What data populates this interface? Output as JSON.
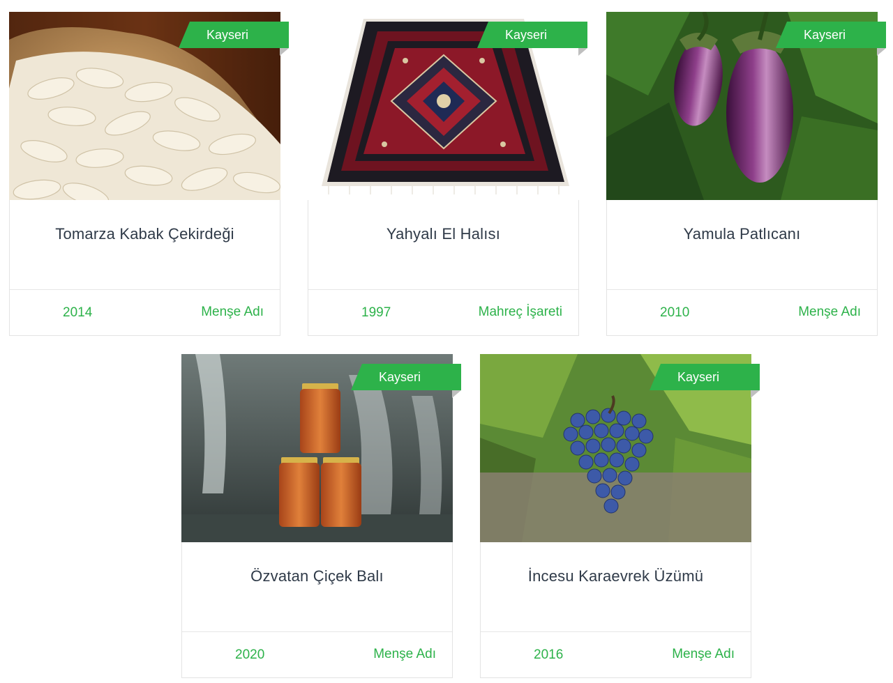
{
  "products": [
    {
      "region": "Kayseri",
      "name": "Tomarza Kabak Çekirdeği",
      "year": "2014",
      "type": "Menşe Adı",
      "image": "pumpkin-seeds"
    },
    {
      "region": "Kayseri",
      "name": "Yahyalı El Halısı",
      "year": "1997",
      "type": "Mahreç İşareti",
      "image": "carpet"
    },
    {
      "region": "Kayseri",
      "name": "Yamula Patlıcanı",
      "year": "2010",
      "type": "Menşe Adı",
      "image": "eggplant"
    },
    {
      "region": "Kayseri",
      "name": "Özvatan Çiçek Balı",
      "year": "2020",
      "type": "Menşe Adı",
      "image": "honey-jars"
    },
    {
      "region": "Kayseri",
      "name": "İncesu Karaevrek Üzümü",
      "year": "2016",
      "type": "Menşe Adı",
      "image": "grapes"
    }
  ],
  "colors": {
    "accent": "#2db24a",
    "title": "#2f3a48",
    "border": "#e3e3e3"
  }
}
